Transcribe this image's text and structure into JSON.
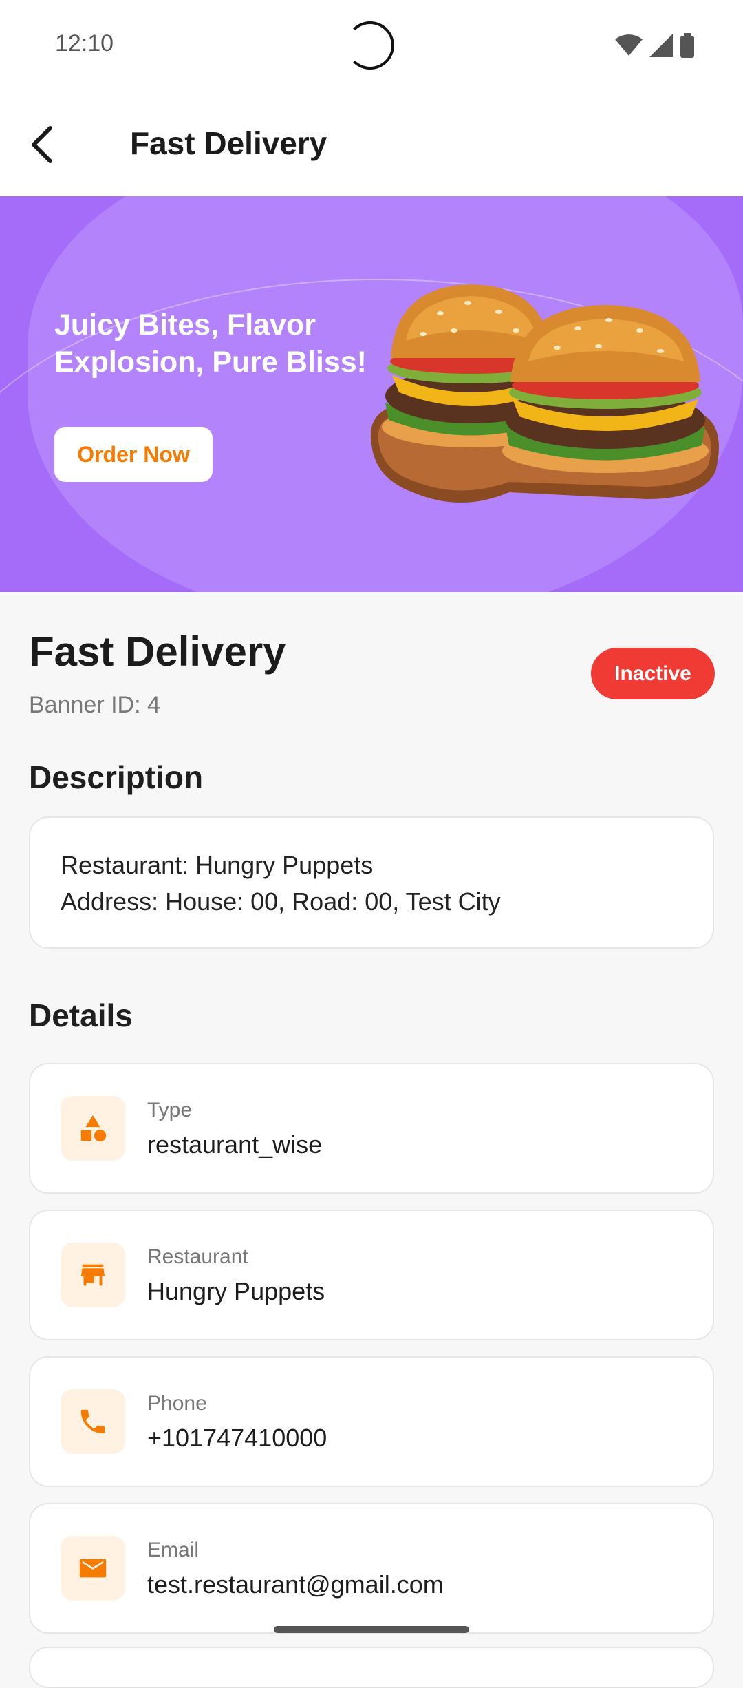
{
  "status_bar": {
    "time": "12:10"
  },
  "app_bar": {
    "title": "Fast Delivery"
  },
  "banner": {
    "headline": "Juicy Bites, Flavor Explosion, Pure Bliss!",
    "cta_label": "Order Now",
    "background_color": "#a46cf9"
  },
  "detail": {
    "title": "Fast Delivery",
    "banner_id": "Banner ID: 4",
    "status": "Inactive",
    "status_color": "#ef3b33"
  },
  "description": {
    "heading": "Description",
    "restaurant_line": "Restaurant: Hungry Puppets",
    "address_line": "Address: House: 00, Road: 00, Test City"
  },
  "details": {
    "heading": "Details",
    "items": [
      {
        "label": "Type",
        "value": "restaurant_wise",
        "icon": "category-icon"
      },
      {
        "label": "Restaurant",
        "value": "Hungry Puppets",
        "icon": "store-icon"
      },
      {
        "label": "Phone",
        "value": "+101747410000",
        "icon": "phone-icon"
      },
      {
        "label": "Email",
        "value": "test.restaurant@gmail.com",
        "icon": "mail-icon"
      }
    ]
  },
  "accent_color": "#f57c00"
}
